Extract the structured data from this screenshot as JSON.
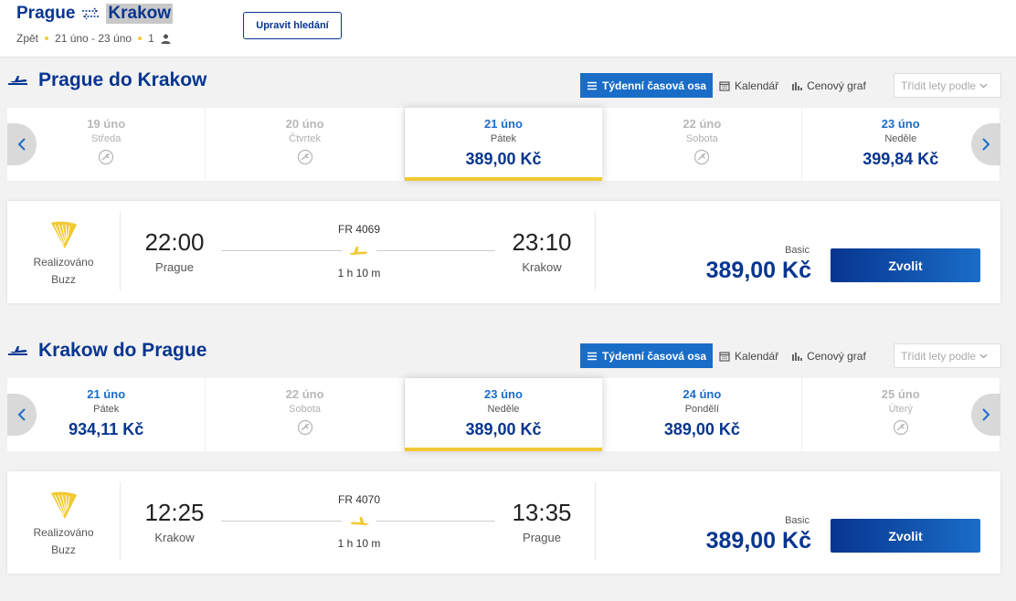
{
  "header": {
    "origin": "Prague",
    "destination": "Krakow",
    "trip_type": "Zpět",
    "dates": "21 úno - 23 úno",
    "passengers": "1",
    "edit_button": "Upravit hledání"
  },
  "view_tabs": {
    "weekly": "Týdenní časová osa",
    "calendar": "Kalendář",
    "price_chart": "Cenový graf",
    "sort_placeholder": "Třídit lety podle"
  },
  "outbound": {
    "title": "Prague do Krakow",
    "days": [
      {
        "date": "19 úno",
        "weekday": "Středa",
        "price": "",
        "available": false,
        "selected": false
      },
      {
        "date": "20 úno",
        "weekday": "Čtvrtek",
        "price": "",
        "available": false,
        "selected": false
      },
      {
        "date": "21 úno",
        "weekday": "Pátek",
        "price": "389,00 Kč",
        "available": true,
        "selected": true
      },
      {
        "date": "22 úno",
        "weekday": "Sobota",
        "price": "",
        "available": false,
        "selected": false
      },
      {
        "date": "23 úno",
        "weekday": "Neděle",
        "price": "399,84 Kč",
        "available": true,
        "selected": false
      }
    ],
    "flight": {
      "operator_line1": "Realizováno",
      "operator_line2": "Buzz",
      "dep_time": "22:00",
      "dep_city": "Prague",
      "flight_number": "FR 4069",
      "duration": "1 h 10 m",
      "arr_time": "23:10",
      "arr_city": "Krakow",
      "fare": "Basic",
      "price": "389,00 Kč",
      "select_label": "Zvolit"
    }
  },
  "inbound": {
    "title": "Krakow do Prague",
    "days": [
      {
        "date": "21 úno",
        "weekday": "Pátek",
        "price": "934,11 Kč",
        "available": true,
        "selected": false
      },
      {
        "date": "22 úno",
        "weekday": "Sobota",
        "price": "",
        "available": false,
        "selected": false
      },
      {
        "date": "23 úno",
        "weekday": "Neděle",
        "price": "389,00 Kč",
        "available": true,
        "selected": true
      },
      {
        "date": "24 úno",
        "weekday": "Pondělí",
        "price": "389,00 Kč",
        "available": true,
        "selected": false
      },
      {
        "date": "25 úno",
        "weekday": "Úterý",
        "price": "",
        "available": false,
        "selected": false
      }
    ],
    "flight": {
      "operator_line1": "Realizováno",
      "operator_line2": "Buzz",
      "dep_time": "12:25",
      "dep_city": "Krakow",
      "flight_number": "FR 4070",
      "duration": "1 h 10 m",
      "arr_time": "13:35",
      "arr_city": "Prague",
      "fare": "Basic",
      "price": "389,00 Kč",
      "select_label": "Zvolit"
    }
  },
  "colors": {
    "brand_blue": "#073590",
    "accent_blue": "#1a6dc7",
    "accent_yellow": "#f1c933"
  }
}
